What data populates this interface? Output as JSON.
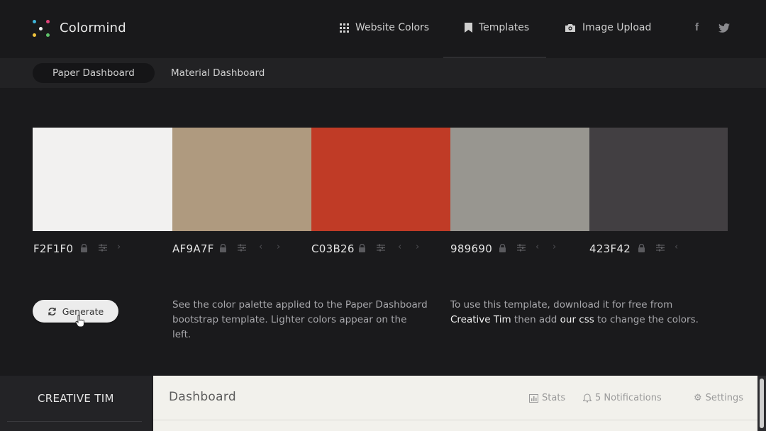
{
  "header": {
    "brand": "Colormind",
    "nav": [
      {
        "label": "Website Colors",
        "icon": "grid-icon"
      },
      {
        "label": "Templates",
        "icon": "bookmark-icon"
      },
      {
        "label": "Image Upload",
        "icon": "camera-icon"
      }
    ],
    "social": [
      {
        "icon": "facebook-icon",
        "glyph": "f"
      },
      {
        "icon": "twitter-icon"
      }
    ]
  },
  "subnav": {
    "tabs": [
      {
        "label": "Paper Dashboard",
        "active": true
      },
      {
        "label": "Material Dashboard",
        "active": false
      }
    ]
  },
  "palette": [
    {
      "hex": "F2F1F0",
      "color": "#F2F1F0"
    },
    {
      "hex": "AF9A7F",
      "color": "#AF9A7F"
    },
    {
      "hex": "C03B26",
      "color": "#C03B26"
    },
    {
      "hex": "989690",
      "color": "#989690"
    },
    {
      "hex": "423F42",
      "color": "#423F42"
    }
  ],
  "generate": {
    "label": "Generate"
  },
  "description": {
    "left": "See the color palette applied to the Paper Dashboard bootstrap template. Lighter colors appear on the left.",
    "right_prefix": "To use this template, download it for free from",
    "right_link1": "Creative Tim",
    "right_mid": "then add",
    "right_link2": "our css",
    "right_suffix": "to change the colors."
  },
  "preview": {
    "sidebar_title": "CREATIVE TIM",
    "dashboard_title": "Dashboard",
    "stats_label": "Stats",
    "notifications_label": "5 Notifications",
    "settings_label": "Settings"
  }
}
